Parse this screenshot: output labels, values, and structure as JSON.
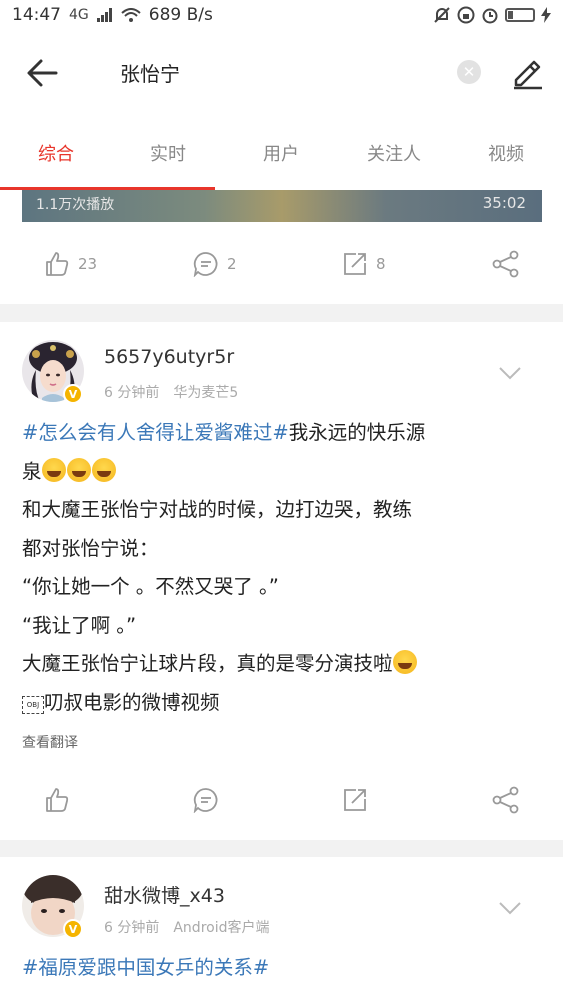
{
  "status_bar": {
    "time": "14:47",
    "network": "4G",
    "speed": "689 B/s"
  },
  "header": {
    "search_query": "张怡宁",
    "clear_glyph": "✕"
  },
  "tabs": [
    {
      "label": "综合",
      "active": true
    },
    {
      "label": "实时",
      "active": false
    },
    {
      "label": "用户",
      "active": false
    },
    {
      "label": "关注人",
      "active": false
    },
    {
      "label": "视频",
      "active": false
    }
  ],
  "colors": {
    "accent": "#e8352b",
    "hashtag": "#3b78b8",
    "badge": "#f5b400"
  },
  "card1": {
    "video_views": "1.1万次播放",
    "video_duration": "35:02",
    "likes": "23",
    "comments": "2",
    "reposts": "8"
  },
  "post1": {
    "username": "5657y6utyr5r",
    "time": "6 分钟前",
    "device": "华为麦芒5",
    "badge": "V",
    "hashtag": "#怎么会有人舍得让爱酱难过#",
    "line1_rest": "我永远的快乐源",
    "line2": "泉",
    "line3": "和大魔王张怡宁对战的时候，边打边哭，教练",
    "line4": "都对张怡宁说：",
    "line5": "“你让她一个 。不然又哭了 。”",
    "line6": "“我让了啊 。”",
    "line7": "大魔王张怡宁让球片段，真的是零分演技啦",
    "obj_label": "OBJ",
    "line8": "叨叔电影的微博视频",
    "translate": "查看翻译"
  },
  "post2": {
    "username": "甜水微博_x43",
    "time": "6 分钟前",
    "device": "Android客户端",
    "badge": "V",
    "hashtag": "#福原爱跟中国女乒的关系#"
  },
  "icons": [
    "back-arrow-icon",
    "clear-icon",
    "compose-icon",
    "like-icon",
    "comment-icon",
    "repost-icon",
    "share-icon",
    "chevron-down-icon",
    "verified-badge-icon"
  ]
}
